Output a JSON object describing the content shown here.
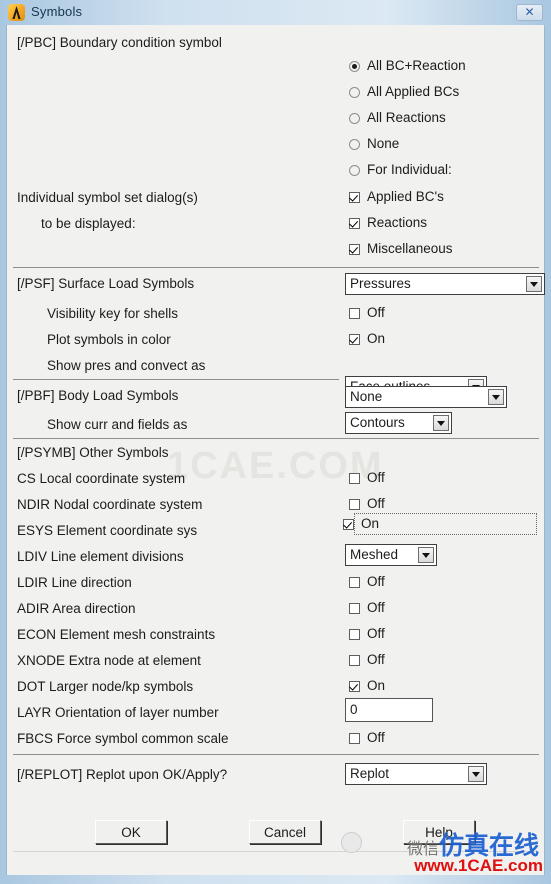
{
  "window": {
    "title": "Symbols",
    "logo_icon": "ansys-logo-icon",
    "close_icon": "close-icon",
    "close_glyph": "✕"
  },
  "sections": {
    "pbc": {
      "heading": "[/PBC] Boundary condition symbol",
      "radios": [
        {
          "label": "All BC+Reaction",
          "checked": true
        },
        {
          "label": "All Applied BCs",
          "checked": false
        },
        {
          "label": "All Reactions",
          "checked": false
        },
        {
          "label": "None",
          "checked": false
        },
        {
          "label": "For Individual:",
          "checked": false
        }
      ],
      "left_label_1": "Individual symbol set dialog(s)",
      "left_label_2": "to be displayed:",
      "checkboxes": [
        {
          "label": "Applied BC's",
          "checked": true
        },
        {
          "label": "Reactions",
          "checked": true
        },
        {
          "label": "Miscellaneous",
          "checked": true
        }
      ]
    },
    "psf": {
      "heading": "[/PSF]  Surface Load Symbols",
      "surface_load_value": "Pressures",
      "rows": [
        {
          "label": "Visibility key for shells",
          "state": "Off",
          "checked": false
        },
        {
          "label": "Plot symbols in color",
          "state": "On",
          "checked": true
        }
      ],
      "show_pres_label": "Show pres and convect as",
      "show_pres_value": "Face outlines"
    },
    "pbf": {
      "heading": "[/PBF]  Body Load Symbols",
      "body_load_value": "None",
      "show_curr_label": "Show curr and fields as",
      "show_curr_value": "Contours"
    },
    "psymb": {
      "heading": "[/PSYMB] Other Symbols",
      "rows": [
        {
          "label": "CS   Local coordinate system",
          "type": "check",
          "state": "Off",
          "checked": false,
          "focused": false
        },
        {
          "label": "NDIR Nodal coordinate system",
          "type": "check",
          "state": "Off",
          "checked": false,
          "focused": false
        },
        {
          "label": "ESYS Element coordinate sys",
          "type": "check",
          "state": "On",
          "checked": true,
          "focused": true
        },
        {
          "label": "LDIV  Line element divisions",
          "type": "dropdown",
          "value": "Meshed"
        },
        {
          "label": "LDIR Line direction",
          "type": "check",
          "state": "Off",
          "checked": false,
          "focused": false
        },
        {
          "label": "ADIR Area direction",
          "type": "check",
          "state": "Off",
          "checked": false,
          "focused": false
        },
        {
          "label": "ECON Element mesh constraints",
          "type": "check",
          "state": "Off",
          "checked": false,
          "focused": false
        },
        {
          "label": "XNODE Extra node at element",
          "type": "check",
          "state": "Off",
          "checked": false,
          "focused": false
        },
        {
          "label": "DOT  Larger node/kp symbols",
          "type": "check",
          "state": "On",
          "checked": true,
          "focused": false
        },
        {
          "label": "LAYR Orientation of layer number",
          "type": "text",
          "value": "0"
        },
        {
          "label": "FBCS Force symbol common scale",
          "type": "check",
          "state": "Off",
          "checked": false,
          "focused": false
        }
      ]
    },
    "replot": {
      "label": "[/REPLOT] Replot upon OK/Apply?",
      "value": "Replot"
    }
  },
  "buttons": {
    "ok": "OK",
    "cancel": "Cancel",
    "help": "Help"
  },
  "watermarks": {
    "center": "1CAE.COM",
    "chinese_prefix": "微信",
    "chinese": "仿真在线",
    "url": "www.1CAE.com"
  }
}
